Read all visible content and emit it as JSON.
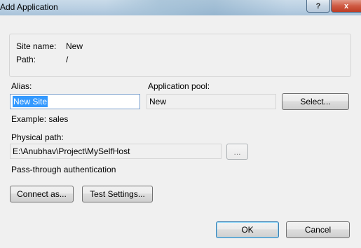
{
  "window": {
    "title": "Add Application",
    "help_label": "?",
    "close_label": "x"
  },
  "info": {
    "site_name_label": "Site name:",
    "site_name_value": "New",
    "path_label": "Path:",
    "path_value": "/"
  },
  "alias": {
    "label": "Alias:",
    "value": "New Site",
    "example": "Example: sales"
  },
  "app_pool": {
    "label": "Application pool:",
    "value": "New",
    "select_label": "Select..."
  },
  "physical_path": {
    "label": "Physical path:",
    "value": "E:\\Anubhav\\Project\\MySelfHost",
    "browse_label": "..."
  },
  "auth": {
    "label": "Pass-through authentication",
    "connect_label": "Connect as...",
    "test_label": "Test Settings..."
  },
  "footer": {
    "ok_label": "OK",
    "cancel_label": "Cancel"
  }
}
